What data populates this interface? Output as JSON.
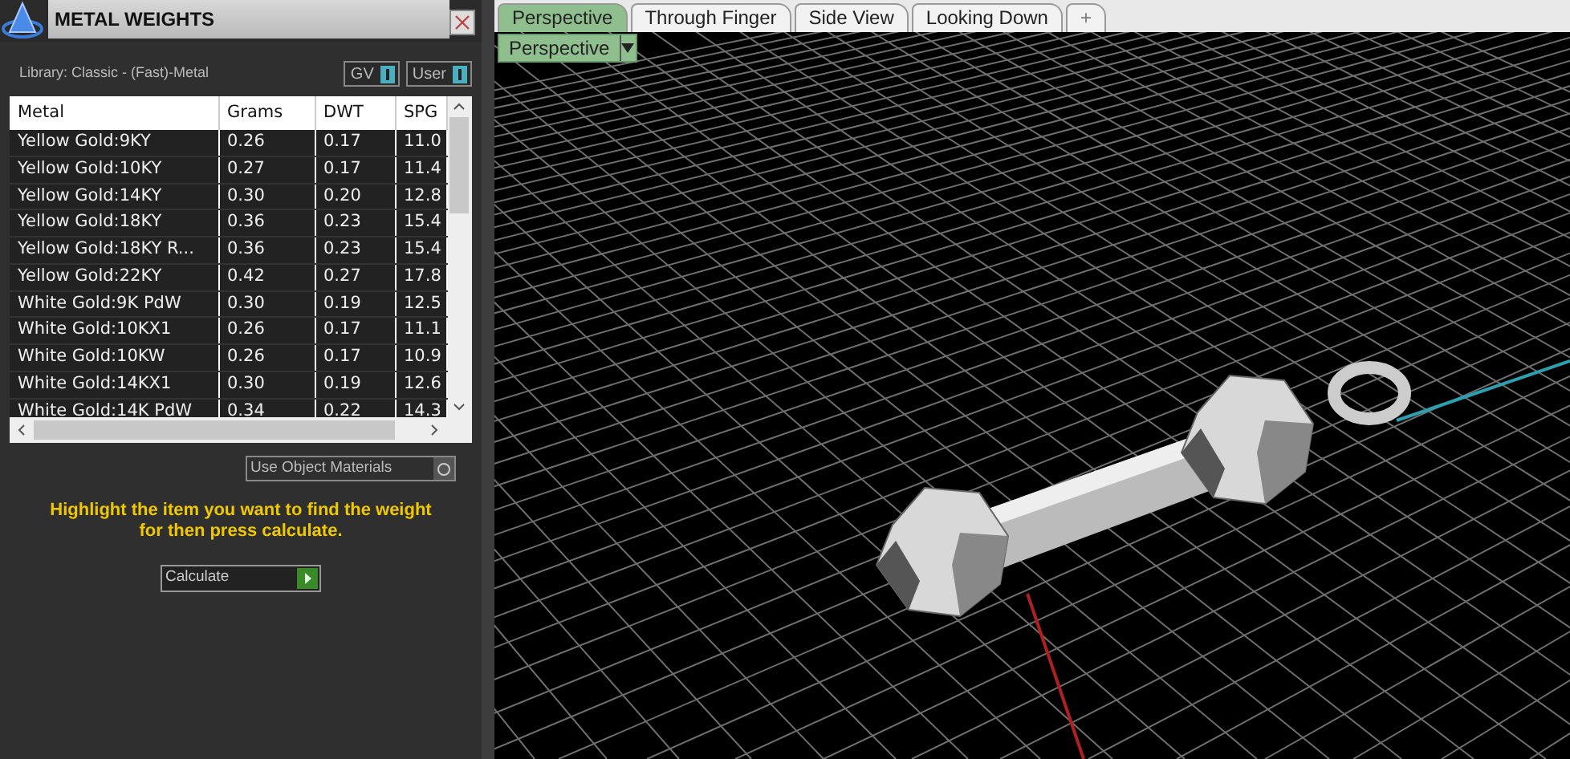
{
  "panel": {
    "title": "METAL WEIGHTS",
    "library": "Library: Classic - (Fast)-Metal",
    "toggles": [
      {
        "label": "GV",
        "on": true
      },
      {
        "label": "User",
        "on": true
      }
    ],
    "table": {
      "columns": [
        "Metal",
        "Grams",
        "DWT",
        "SPG"
      ],
      "rows": [
        [
          "Yellow Gold:9KY",
          "0.26",
          "0.17",
          "11.0"
        ],
        [
          "Yellow Gold:10KY",
          "0.27",
          "0.17",
          "11.4"
        ],
        [
          "Yellow Gold:14KY",
          "0.30",
          "0.20",
          "12.8"
        ],
        [
          "Yellow Gold:18KY",
          "0.36",
          "0.23",
          "15.4"
        ],
        [
          "Yellow Gold:18KY R...",
          "0.36",
          "0.23",
          "15.4"
        ],
        [
          "Yellow Gold:22KY",
          "0.42",
          "0.27",
          "17.8"
        ],
        [
          "White Gold:9K PdW",
          "0.30",
          "0.19",
          "12.5"
        ],
        [
          "White Gold:10KX1",
          "0.26",
          "0.17",
          "11.1"
        ],
        [
          "White Gold:10KW",
          "0.26",
          "0.17",
          "10.9"
        ],
        [
          "White Gold:14KX1",
          "0.30",
          "0.19",
          "12.6"
        ],
        [
          "White Gold:14K PdW",
          "0.34",
          "0.22",
          "14.3"
        ]
      ]
    },
    "use_object_materials": {
      "label": "Use Object Materials",
      "checked": false
    },
    "instructions": "Highlight the item you want to find the weight for then press calculate.",
    "calculate_button": "Calculate"
  },
  "viewport": {
    "tabs": [
      {
        "label": "Perspective",
        "selected": true
      },
      {
        "label": "Through Finger",
        "selected": false
      },
      {
        "label": "Side View",
        "selected": false
      },
      {
        "label": "Looking Down",
        "selected": false
      }
    ],
    "add_tab": "+",
    "view_dropdown": "Perspective"
  }
}
